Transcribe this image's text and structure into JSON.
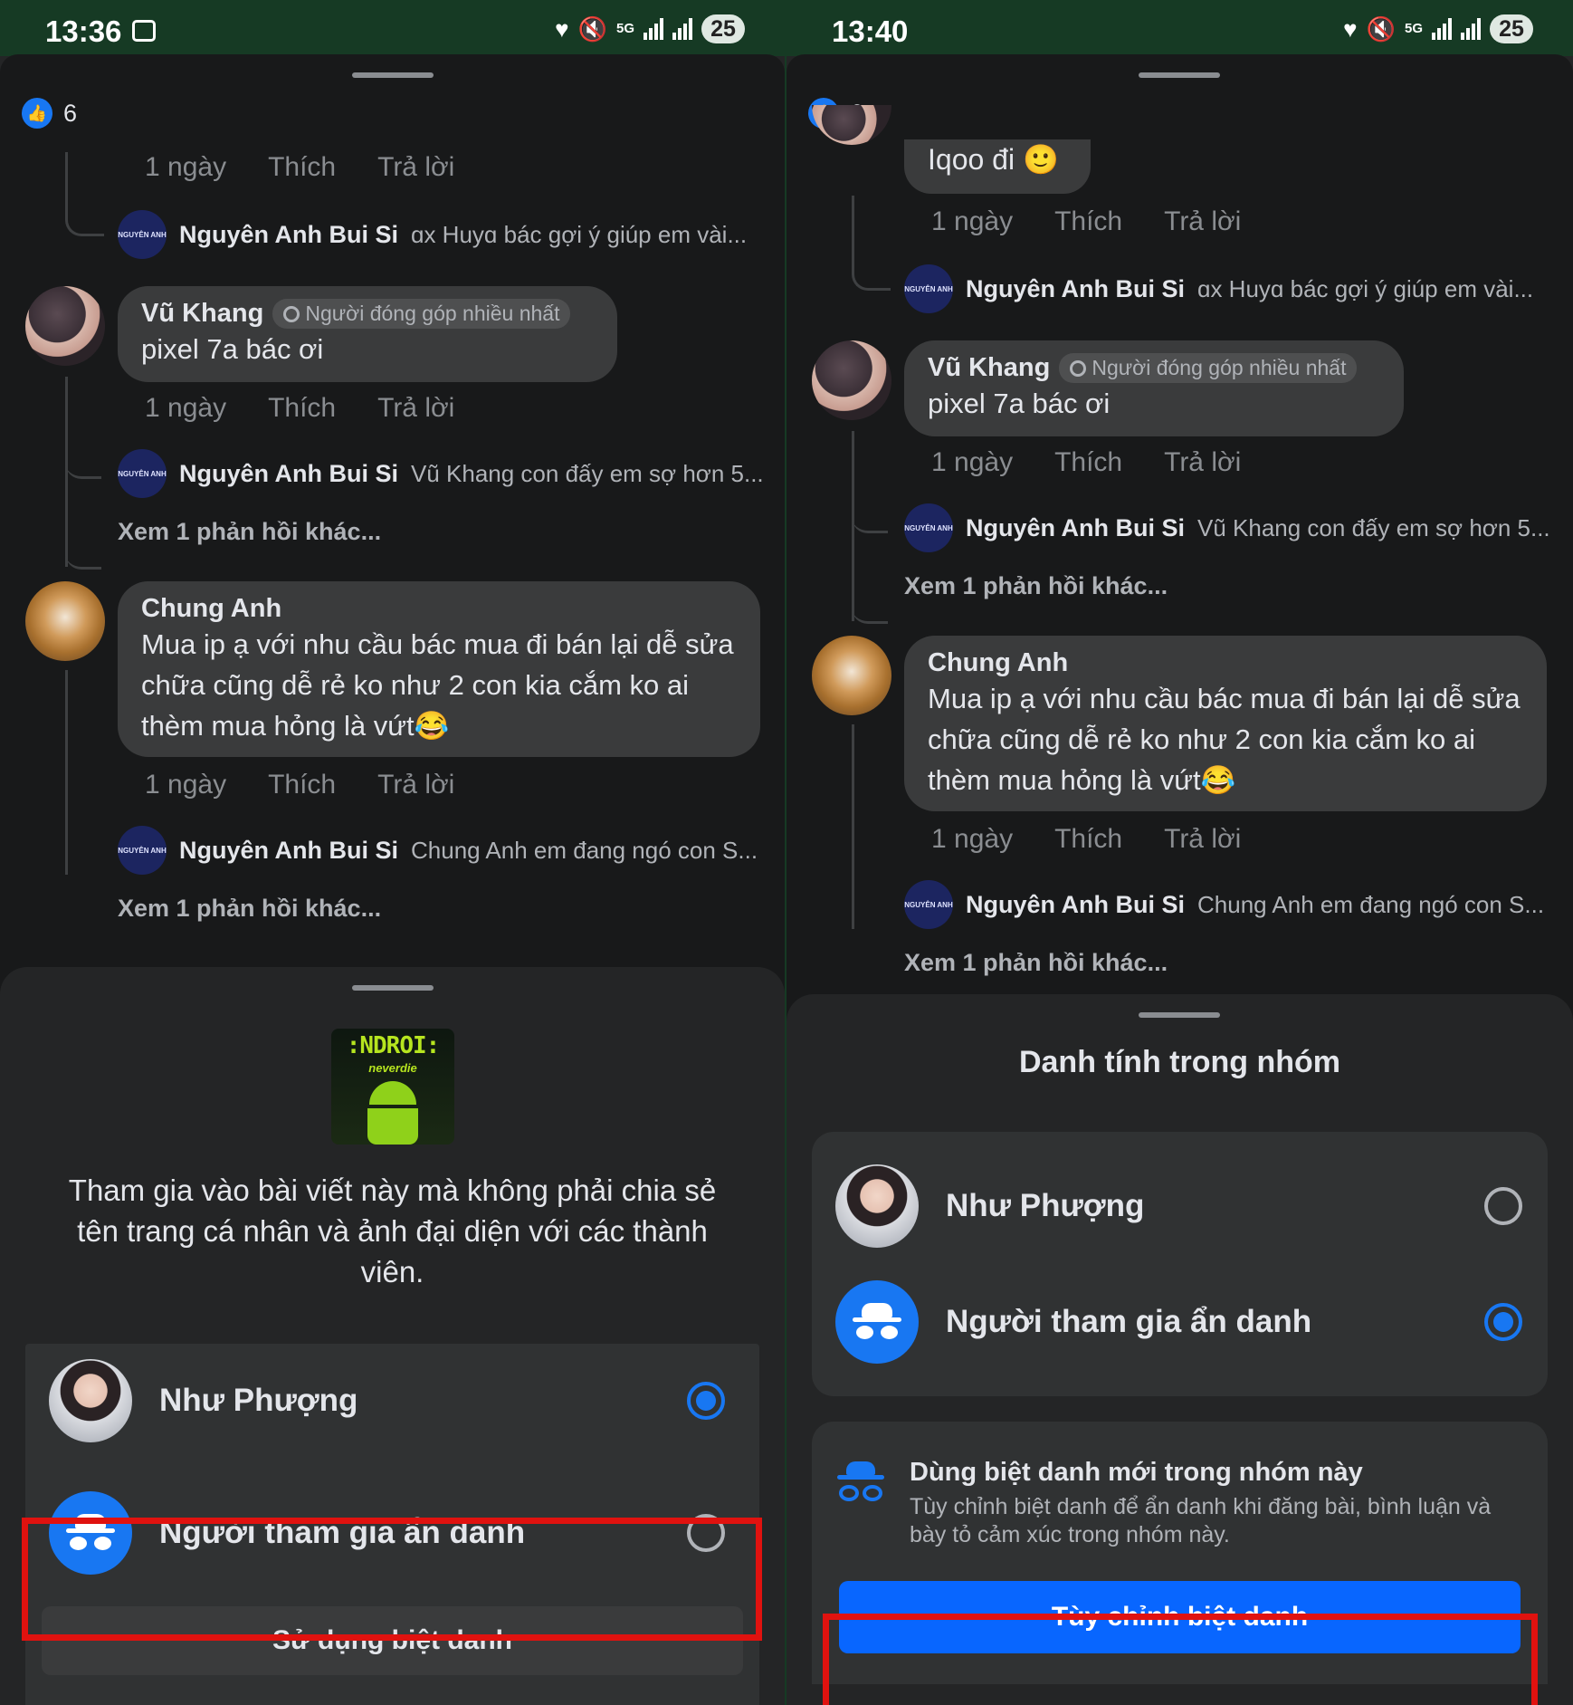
{
  "left": {
    "status": {
      "time": "13:36",
      "battery": "25",
      "network": "5G"
    },
    "likes": "6",
    "top_meta": {
      "time": "1 ngày",
      "like": "Thích",
      "reply": "Trả lời"
    },
    "reply1": {
      "avatar_text": "NGUYÊN ANH",
      "name": "Nguyên Anh Bui Si",
      "text": "ɑx Huyɑ bác gợi ý giúp em vài..."
    },
    "comment1": {
      "name": "Vũ Khang",
      "badge": "Người đóng góp nhiều nhất",
      "text": "pixel 7a bác ơi",
      "time": "1 ngày",
      "like": "Thích",
      "reply": "Trả lời"
    },
    "reply2": {
      "avatar_text": "NGUYÊN ANH",
      "name": "Nguyên Anh Bui Si",
      "text": "Vũ Khang con đấy em sợ hơn 5..."
    },
    "more1": "Xem 1 phản hồi khác...",
    "comment2": {
      "name": "Chung Anh",
      "text": "Mua ip ạ với nhu cầu bác mua đi bán lại dễ sửa chữa cũng dễ rẻ ko như 2 con kia cắm ko ai thèm mua hỏng là vứt😂",
      "time": "1 ngày",
      "like": "Thích",
      "reply": "Trả lời"
    },
    "reply3": {
      "avatar_text": "NGUYÊN ANH",
      "name": "Nguyên Anh Bui Si",
      "text": "Chung Anh em đang ngó con S..."
    },
    "more2": "Xem 1 phản hồi khác...",
    "sheet": {
      "logo_text": ":NDROI:",
      "logo_sub": "neverdie",
      "description": "Tham gia vào bài viết này mà không phải chia sẻ tên trang cá nhân và ảnh đại diện với các thành viên.",
      "option1": "Như Phượng",
      "option2": "Người tham gia ẩn danh",
      "button": "Sử dụng biệt danh"
    }
  },
  "right": {
    "status": {
      "time": "13:40",
      "battery": "25",
      "network": "5G"
    },
    "likes": "6",
    "top_bubble": "Iqoo đi 🙂",
    "top_meta": {
      "time": "1 ngày",
      "like": "Thích",
      "reply": "Trả lời"
    },
    "reply1": {
      "avatar_text": "NGUYÊN ANH",
      "name": "Nguyên Anh Bui Si",
      "text": "ɑx Huyɑ bác gợi ý giúp em vài..."
    },
    "comment1": {
      "name": "Vũ Khang",
      "badge": "Người đóng góp nhiều nhất",
      "text": "pixel 7a bác ơi",
      "time": "1 ngày",
      "like": "Thích",
      "reply": "Trả lời"
    },
    "reply2": {
      "avatar_text": "NGUYÊN ANH",
      "name": "Nguyên Anh Bui Si",
      "text": "Vũ Khang con đấy em sợ hơn 5..."
    },
    "more1": "Xem 1 phản hồi khác...",
    "comment2": {
      "name": "Chung Anh",
      "text": "Mua ip ạ với nhu cầu bác mua đi bán lại dễ sửa chữa cũng dễ rẻ ko như 2 con kia cắm ko ai thèm mua hỏng là vứt😂",
      "time": "1 ngày",
      "like": "Thích",
      "reply": "Trả lời"
    },
    "reply3": {
      "avatar_text": "NGUYÊN ANH",
      "name": "Nguyên Anh Bui Si",
      "text": "Chung Anh em đang ngó con S..."
    },
    "more2": "Xem 1 phản hồi khác...",
    "sheet": {
      "title": "Danh tính trong nhóm",
      "option1": "Như Phượng",
      "option2": "Người tham gia ẩn danh",
      "nick_title": "Dùng biệt danh mới trong nhóm này",
      "nick_desc": "Tùy chỉnh biệt danh để ẩn danh khi đăng bài, bình luận và bày tỏ cảm xúc trong nhóm này.",
      "button": "Tùy chỉnh biệt danh"
    }
  },
  "colors": {
    "accent": "#1877f2",
    "highlight": "#e0120f",
    "background": "#18191a",
    "sheet": "#242526"
  }
}
